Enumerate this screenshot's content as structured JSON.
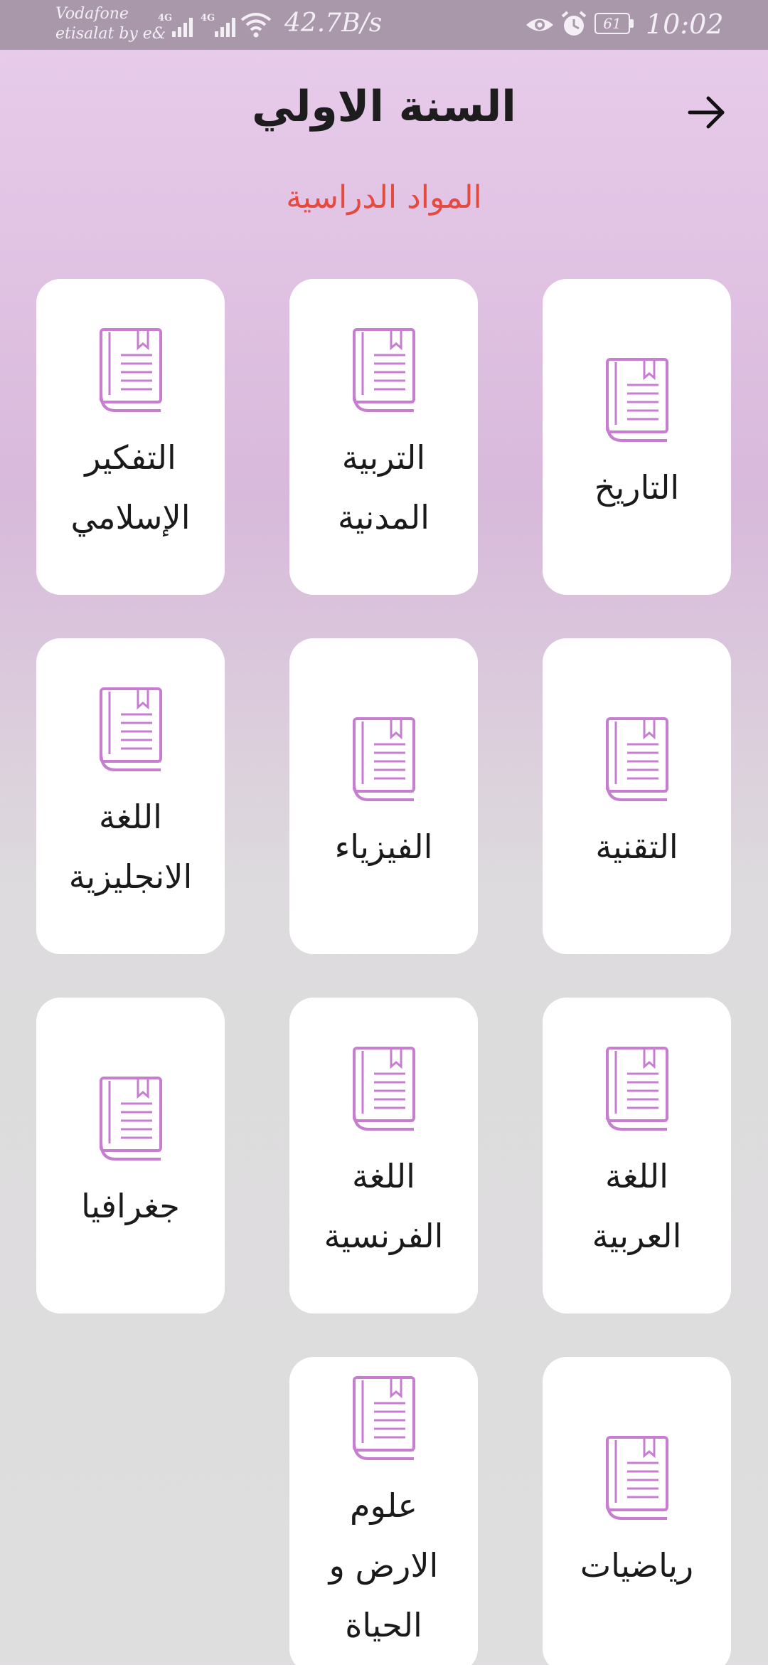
{
  "status_bar": {
    "carrier_line1": "Vodafone",
    "carrier_line2": "etisalat by e&",
    "network_tag_1": "4G",
    "network_tag_2": "4G",
    "net_speed": "42.7B/s",
    "battery_level": "61",
    "time": "10:02",
    "icons": [
      "signal-icon",
      "wifi-icon",
      "eye-icon",
      "alarm-icon",
      "battery-icon"
    ]
  },
  "header": {
    "title": "السنة الاولي",
    "back_icon": "arrow-right-icon"
  },
  "section": {
    "title": "المواد الدراسية"
  },
  "colors": {
    "accent_red": "#e44a3e",
    "book_icon": "#c77ed0",
    "status_bar": "#a898aa",
    "card": "#ffffff"
  },
  "subjects": [
    {
      "label": "التاريخ",
      "icon": "book-icon"
    },
    {
      "label": "التربية\nالمدنية",
      "icon": "book-icon"
    },
    {
      "label": "التفكير\nالإسلامي",
      "icon": "book-icon"
    },
    {
      "label": "التقنية",
      "icon": "book-icon"
    },
    {
      "label": "الفيزياء",
      "icon": "book-icon"
    },
    {
      "label": "اللغة\nالانجليزية",
      "icon": "book-icon"
    },
    {
      "label": "اللغة\nالعربية",
      "icon": "book-icon"
    },
    {
      "label": "اللغة\nالفرنسية",
      "icon": "book-icon"
    },
    {
      "label": "جغرافيا",
      "icon": "book-icon"
    },
    {
      "label": "رياضيات",
      "icon": "book-icon"
    },
    {
      "label": "علوم\nالارض و\nالحياة",
      "icon": "book-icon"
    }
  ]
}
